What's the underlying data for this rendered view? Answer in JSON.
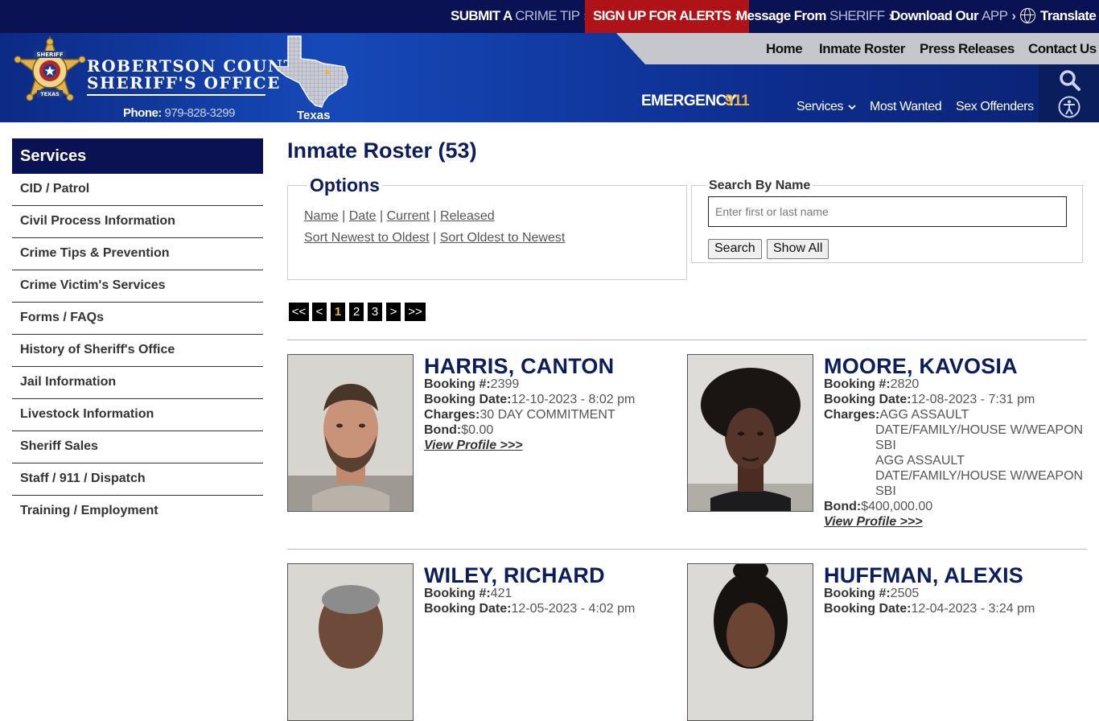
{
  "topbar": {
    "crime_tip_a": "SUBMIT A",
    "crime_tip_b": "CRIME TIP",
    "alerts": "SIGN UP FOR ALERTS",
    "message_a": "Message From",
    "message_b": "SHERIFF",
    "download_a": "Download Our",
    "download_b": "APP",
    "translate": "Translate"
  },
  "header": {
    "title_line1": "ROBERTSON COUNTY",
    "title_line2": "SHERIFF'S OFFICE",
    "badge_top": "SHERIFF",
    "badge_mid1": "ROBERTSON",
    "badge_mid2": "COUNTY",
    "badge_bottom": "TEXAS",
    "phone_label": "Phone:",
    "phone_number": "979-828-3299",
    "texas_label": "Texas",
    "emergency_label": "EMERGENCY",
    "emergency_number": "911",
    "nav_top": [
      "Home",
      "Inmate Roster",
      "Press Releases",
      "Contact Us"
    ],
    "nav_bottom": [
      "Services",
      "Most Wanted",
      "Sex Offenders"
    ]
  },
  "sidebar": {
    "heading": "Services",
    "items": [
      "CID / Patrol",
      "Civil Process Information",
      "Crime Tips & Prevention",
      "Crime Victim's Services",
      "Forms / FAQs",
      "History of Sheriff's Office",
      "Jail Information",
      "Livestock Information",
      "Sheriff Sales",
      "Staff / 911 / Dispatch",
      "Training / Employment"
    ]
  },
  "main": {
    "page_title": "Inmate Roster (53)",
    "options": {
      "legend": "Options",
      "sort_name": "Name",
      "sort_date": "Date",
      "sort_current": "Current",
      "sort_released": "Released",
      "sep": "|",
      "newest": "Sort Newest to Oldest",
      "oldest": "Sort Oldest to Newest"
    },
    "search": {
      "legend": "Search By Name",
      "placeholder": "Enter first or last name",
      "search_button": "Search",
      "show_all_button": "Show All"
    },
    "pagination": [
      "<<",
      "<",
      "1",
      "2",
      "3",
      ">",
      ">>"
    ],
    "current_page": "1",
    "labels": {
      "booking": "Booking #:",
      "booking_date": "Booking Date:",
      "charges": "Charges:",
      "bond": "Bond:",
      "view_profile": "View Profile >>>"
    },
    "inmates": [
      {
        "name": "HARRIS, CANTON",
        "booking": "2399",
        "booking_date": "12-10-2023 - 8:02 pm",
        "charges_first": "30 DAY COMMITMENT",
        "charges_more": [],
        "bond": "$0.00"
      },
      {
        "name": "MOORE, KAVOSIA",
        "booking": "2820",
        "booking_date": "12-08-2023 - 7:31 pm",
        "charges_first": "AGG ASSAULT",
        "charges_more": [
          "DATE/FAMILY/HOUSE W/WEAPON",
          "SBI",
          "AGG ASSAULT",
          "DATE/FAMILY/HOUSE W/WEAPON",
          "SBI"
        ],
        "bond": "$400,000.00"
      },
      {
        "name": "WILEY, RICHARD",
        "booking": "421",
        "booking_date": "12-05-2023 - 4:02 pm"
      },
      {
        "name": "HUFFMAN, ALEXIS",
        "booking": "2505",
        "booking_date": "12-04-2023 - 3:24 pm"
      }
    ]
  }
}
